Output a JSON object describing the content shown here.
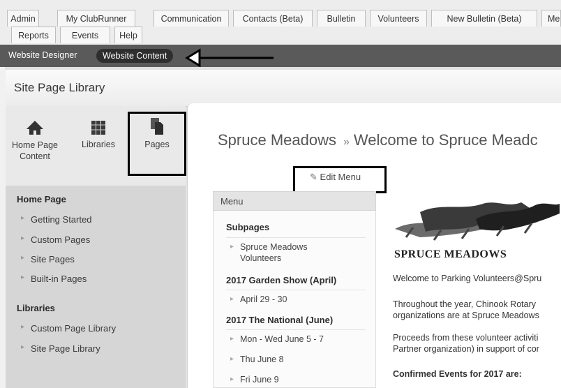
{
  "top_tabs_row1": [
    "Admin",
    "My ClubRunner",
    "Communication",
    "Contacts (Beta)",
    "Bulletin",
    "Volunteers",
    "New Bulletin (Beta)",
    "Me"
  ],
  "top_tabs_row2": [
    "Reports",
    "Events",
    "Help"
  ],
  "designer_bar": {
    "website_designer": "Website Designer",
    "website_content": "Website Content"
  },
  "library_title": "Site Page Library",
  "leftnav": {
    "home_page_content": "Home Page\nContent",
    "libraries": "Libraries",
    "pages": "Pages"
  },
  "tree": {
    "home_page_heading": "Home Page",
    "home_page_items": [
      "Getting Started",
      "Custom Pages",
      "Site Pages",
      "Built-in Pages"
    ],
    "libraries_heading": "Libraries",
    "library_items": [
      "Custom Page Library",
      "Site Page Library"
    ]
  },
  "page_header": {
    "site_name": "Spruce Meadows",
    "separator": "»",
    "page_name": "Welcome to Spruce Meadc"
  },
  "edit_menu": "Edit Menu",
  "menu": {
    "heading": "Menu",
    "subpages_heading": "Subpages",
    "subpages": [
      "Spruce Meadows\nVolunteers"
    ],
    "garden_heading": "2017 Garden Show (April)",
    "garden_items": [
      "April 29 - 30"
    ],
    "national_heading": "2017 The National (June)",
    "national_items": [
      "Mon - Wed June 5 - 7",
      "Thu June 8",
      "Fri June 9"
    ]
  },
  "article": {
    "logo_text": "SPRUCE MEADOWS",
    "p1": "Welcome to Parking Volunteers@Spru",
    "p2": "Throughout the year, Chinook Rotary\norganizations are at Spruce Meadows",
    "p3": "Proceeds from these volunteer activiti\nPartner organization) in support of cor",
    "p4": "Confirmed Events for 2017 are:"
  }
}
